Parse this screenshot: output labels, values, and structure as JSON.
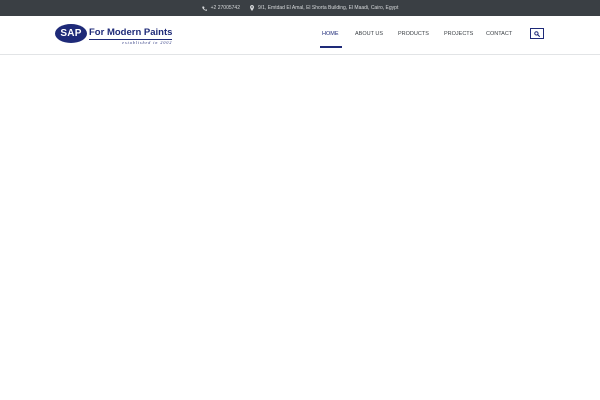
{
  "topbar": {
    "phone_icon": "phone-icon",
    "phone": "+2 27005742",
    "location_icon": "map-pin-icon",
    "address": "9/1, Emtdad El Amal, El Shorta Building, El Maadi, Cairo, Egypt"
  },
  "logo": {
    "mark": "SAP",
    "name": "For Modern Paints",
    "tagline": "established in 2002"
  },
  "nav": {
    "items": [
      {
        "label": "HOME",
        "active": true
      },
      {
        "label": "ABOUT US",
        "active": false
      },
      {
        "label": "PRODUCTS",
        "active": false
      },
      {
        "label": "PROJECTS",
        "active": false
      },
      {
        "label": "CONTACT",
        "active": false
      }
    ],
    "search_icon": "search-icon"
  },
  "colors": {
    "topbar_bg": "#3a3f44",
    "brand": "#1e2a78",
    "nav_text": "#3a3f44"
  }
}
